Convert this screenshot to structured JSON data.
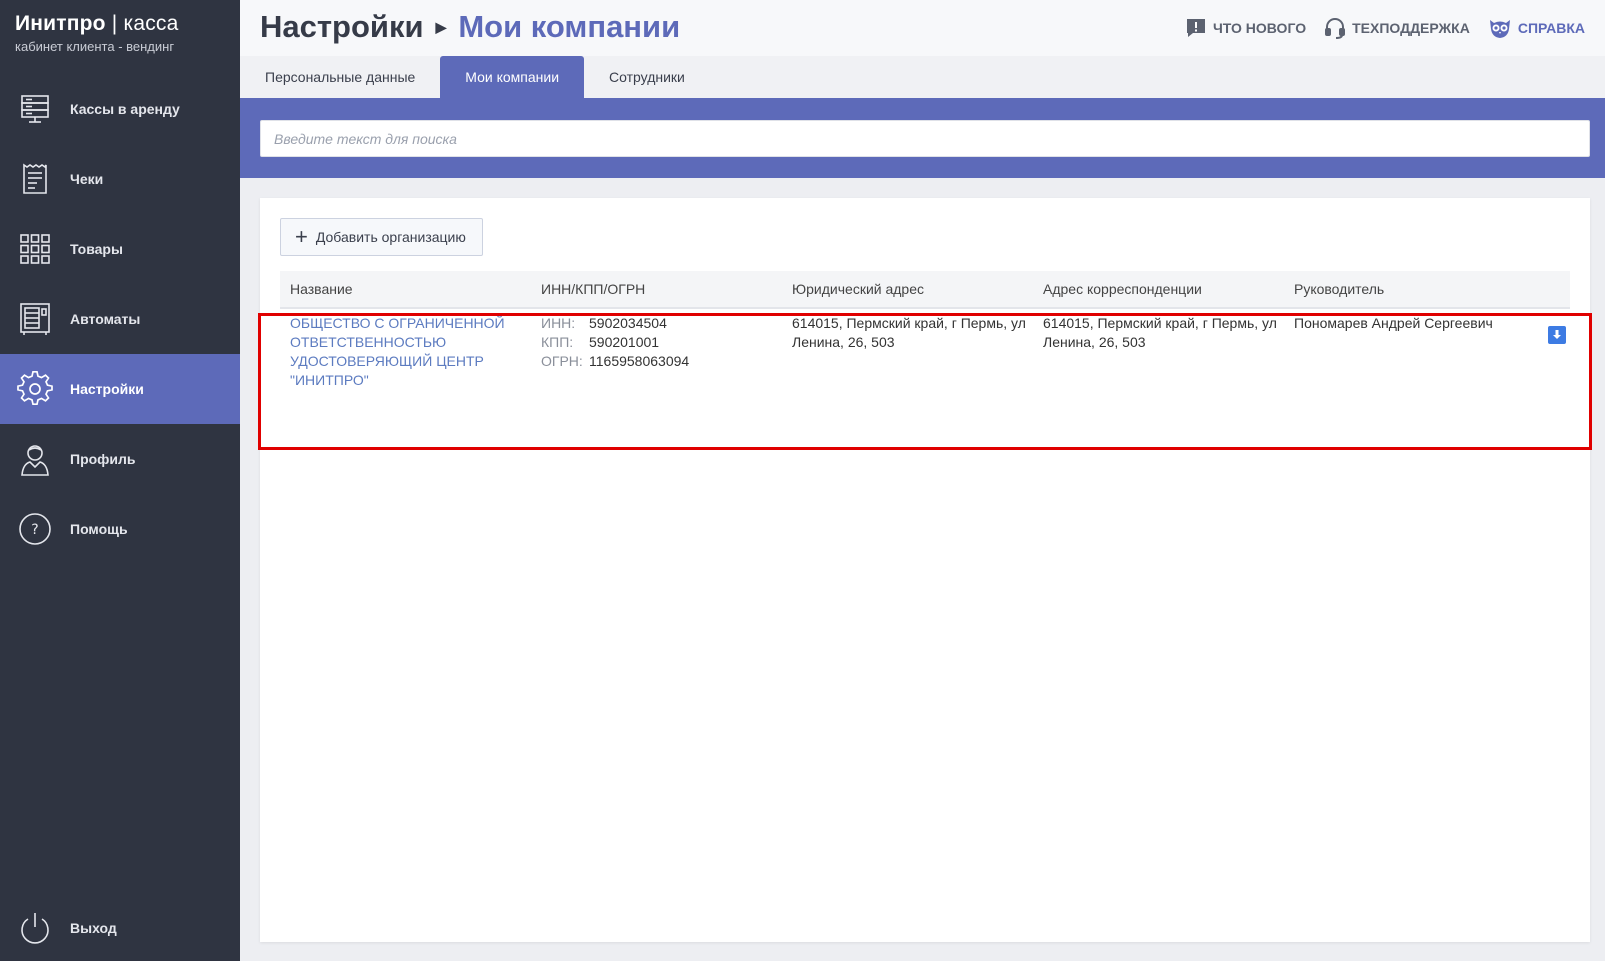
{
  "brand": {
    "name": "Инитпро",
    "separator": "|",
    "product": "касса",
    "subtitle": "кабинет клиента - вендинг"
  },
  "sidebar": {
    "items": [
      {
        "label": "Кассы в аренду",
        "icon": "server-icon"
      },
      {
        "label": "Чеки",
        "icon": "receipt-icon"
      },
      {
        "label": "Товары",
        "icon": "grid-icon"
      },
      {
        "label": "Автоматы",
        "icon": "vending-machine-icon"
      },
      {
        "label": "Настройки",
        "icon": "gear-icon",
        "active": true
      },
      {
        "label": "Профиль",
        "icon": "user-icon"
      },
      {
        "label": "Помощь",
        "icon": "question-icon"
      }
    ],
    "logout": {
      "label": "Выход",
      "icon": "power-icon"
    }
  },
  "header": {
    "breadcrumb_root": "Настройки",
    "breadcrumb_current": "Мои компании",
    "links": {
      "whats_new": "ЧТО НОВОГО",
      "support": "ТЕХПОДДЕРЖКА",
      "help": "СПРАВКА"
    }
  },
  "tabs": [
    {
      "label": "Персональные данные"
    },
    {
      "label": "Мои компании",
      "active": true
    },
    {
      "label": "Сотрудники"
    }
  ],
  "search": {
    "placeholder": "Введите текст для поиска"
  },
  "toolbar": {
    "add_label": "Добавить организацию"
  },
  "table": {
    "columns": [
      "Название",
      "ИНН/КПП/ОГРН",
      "Юридический адрес",
      "Адрес корреспонденции",
      "Руководитель"
    ],
    "rows": [
      {
        "name": "ОБЩЕСТВО С ОГРАНИЧЕННОЙ ОТВЕТСТВЕННОСТЬЮ УДОСТОВЕРЯЮЩИЙ ЦЕНТР \"ИНИТПРО\"",
        "inn_key": "ИНН:",
        "inn": "5902034504",
        "kpp_key": "КПП:",
        "kpp": "590201001",
        "ogrn_key": "ОГРН:",
        "ogrn": "1165958063094",
        "legal_address": "614015, Пермский край, г Пермь, ул Ленина, 26, 503",
        "mail_address": "614015, Пермский край, г Пермь, ул Ленина, 26, 503",
        "director": "Пономарев Андрей Сергеевич"
      }
    ]
  },
  "colors": {
    "sidebar": "#2f3441",
    "accent": "#5d6ab9",
    "link": "#5c7bc0",
    "highlight": "#e00000"
  }
}
